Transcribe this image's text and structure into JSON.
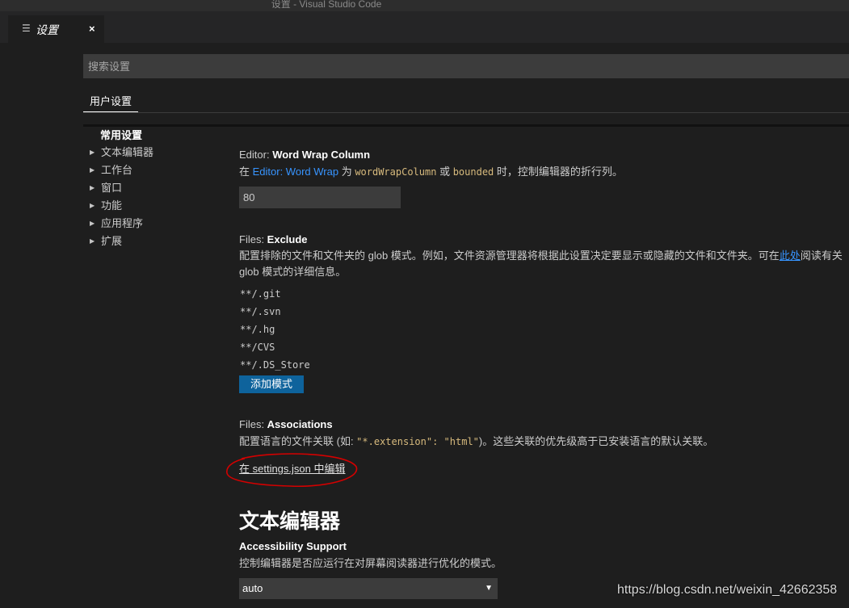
{
  "window": {
    "title": "设置 - Visual Studio Code"
  },
  "tab": {
    "label": "设置",
    "close": "×",
    "icon": "settings-lines-icon"
  },
  "search": {
    "placeholder": "搜索设置"
  },
  "scope_tabs": [
    {
      "label": "用户设置"
    }
  ],
  "toc": {
    "header": "常用设置",
    "items": [
      {
        "label": "文本编辑器"
      },
      {
        "label": "工作台"
      },
      {
        "label": "窗口"
      },
      {
        "label": "功能"
      },
      {
        "label": "应用程序"
      },
      {
        "label": "扩展"
      }
    ]
  },
  "settings": {
    "word_wrap_column": {
      "category": "Editor: ",
      "name": "Word Wrap Column",
      "desc_1": "在 ",
      "desc_link": "Editor: Word Wrap",
      "desc_2": " 为 ",
      "desc_code_1": "wordWrapColumn",
      "desc_3": " 或 ",
      "desc_code_2": "bounded",
      "desc_4": " 时，控制编辑器的折行列。",
      "value": "80"
    },
    "files_exclude": {
      "category": "Files: ",
      "name": "Exclude",
      "desc_1": "配置排除的文件和文件夹的 glob 模式。例如，文件资源管理器将根据此设置决定要显示或隐藏的文件和文件夹。可在",
      "desc_link": "此处",
      "desc_2": "阅读有关",
      "desc_3": "glob 模式的详细信息。",
      "patterns": [
        "**/.git",
        "**/.svn",
        "**/.hg",
        "**/CVS",
        "**/.DS_Store"
      ],
      "add_button": "添加模式"
    },
    "files_associations": {
      "category": "Files: ",
      "name": "Associations",
      "desc_1": "配置语言的文件关联 (如: ",
      "desc_code": "\"*.extension\": \"html\"",
      "desc_2": ")。这些关联的优先级高于已安装语言的默认关联。",
      "edit_link": "在 settings.json 中编辑"
    },
    "section_title": "文本编辑器",
    "accessibility_support": {
      "name": "Accessibility Support",
      "desc": "控制编辑器是否应运行在对屏幕阅读器进行优化的模式。",
      "value": "auto",
      "arrow": "▼"
    }
  },
  "watermark": "https://blog.csdn.net/weixin_42662358",
  "colors": {
    "background": "#1e1e1e",
    "link": "#3794ff",
    "button": "#0e639c",
    "annotation": "#d40000"
  }
}
